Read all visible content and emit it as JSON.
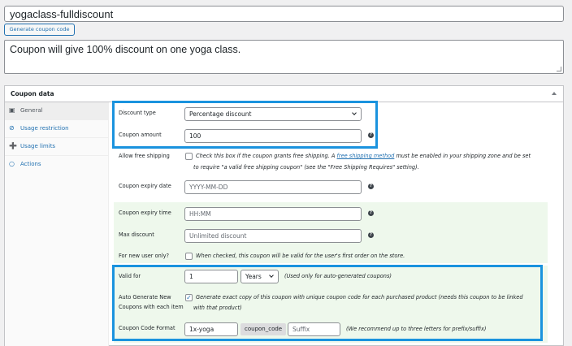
{
  "coupon": {
    "code": "yogaclass-fulldiscount",
    "generate_label": "Generate coupon code",
    "description": "Coupon will give 100% discount on one yoga class."
  },
  "panel": {
    "title": "Coupon data",
    "tabs": [
      {
        "label": "General",
        "icon": "ticket-icon",
        "active": true
      },
      {
        "label": "Usage restriction",
        "icon": "block-icon"
      },
      {
        "label": "Usage limits",
        "icon": "plus-icon"
      },
      {
        "label": "Actions",
        "icon": "circle-icon"
      }
    ]
  },
  "general": {
    "discount_type_label": "Discount type",
    "discount_type_value": "Percentage discount",
    "amount_label": "Coupon amount",
    "amount_value": "100",
    "free_shipping_label": "Allow free shipping",
    "free_shipping_note_a": "Check this box if the coupon grants free shipping. A",
    "free_shipping_link": "free shipping method",
    "free_shipping_note_b": "must be enabled in your shipping zone and be set",
    "free_shipping_note_c": "to require \"a valid free shipping coupon\" (see the \"Free Shipping Requires\" setting).",
    "expiry_date_label": "Coupon expiry date",
    "expiry_date_placeholder": "YYYY-MM-DD",
    "expiry_time_label": "Coupon expiry time",
    "expiry_time_placeholder": "HH:MM",
    "max_discount_label": "Max discount",
    "max_discount_placeholder": "Unlimited discount",
    "new_user_label": "For new user only?",
    "new_user_note": "When checked, this coupon will be valid for the user's first order on the store.",
    "valid_for_label": "Valid for",
    "valid_for_value": "1",
    "valid_for_unit": "Years",
    "valid_for_note": "(Used only for auto-generated coupons)",
    "auto_gen_label_1": "Auto Generate New",
    "auto_gen_label_2": "Coupons with each item",
    "auto_gen_note_1": "Generate exact copy of this coupon with unique coupon code for each purchased product (needs this coupon to be linked",
    "auto_gen_note_2": "with that product)",
    "format_label": "Coupon Code Format",
    "prefix_value": "1x-yoga",
    "code_tag": "coupon_code",
    "suffix_placeholder": "Suffix",
    "format_note": "(We recommend up to three letters for prefix/suffix)",
    "help_glyph": "?",
    "checkmark_glyph": "✓"
  },
  "colors": {
    "accent": "#2271b1",
    "highlight": "#1a93de",
    "green_bg": "#eef8ec"
  }
}
